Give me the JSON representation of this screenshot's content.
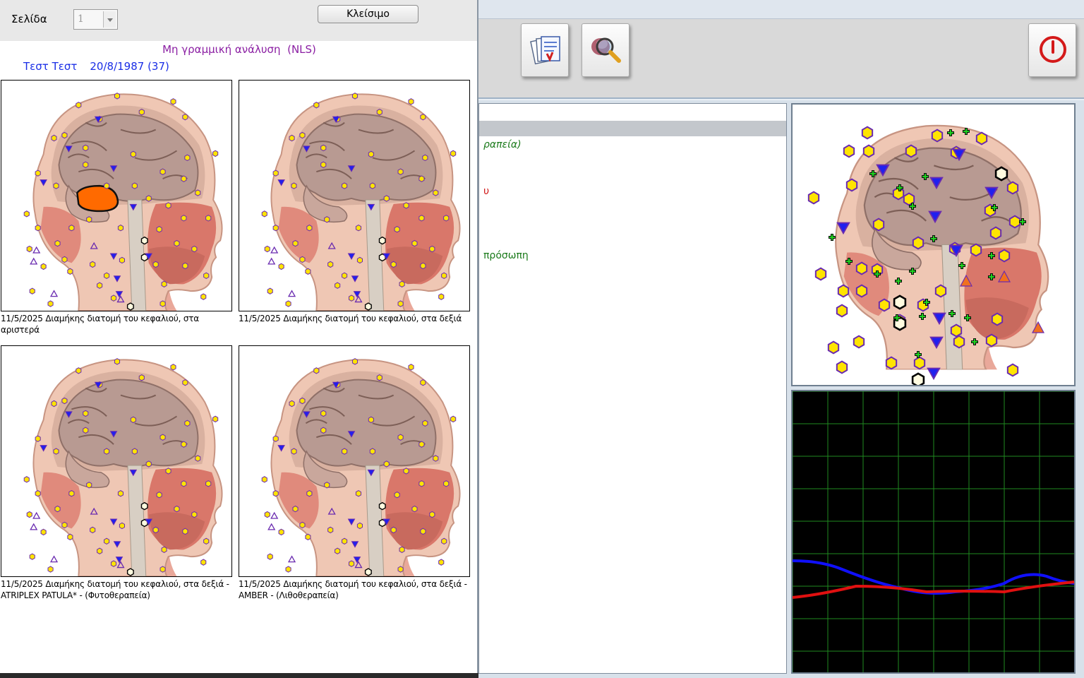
{
  "dialog": {
    "page_label": "Σελίδα",
    "page_value": "1",
    "close_label": "Κλείσιμο",
    "report_title": "Μη γραμμική ανάλυση  (NLS)",
    "patient_name": "Τεστ Τεστ",
    "patient_birth": "20/8/1987 (37)",
    "thumbnails": [
      {
        "caption": "11/5/2025  Διαμήκης διατομή του κεφαλιού, στα αριστερά"
      },
      {
        "caption": "11/5/2025  Διαμήκης διατομή του κεφαλιού, στα δεξιά"
      },
      {
        "caption": "11/5/2025  Διαμήκης διατομή του κεφαλιού, στα δεξιά - ATRIPLEX  PATULA* - (Φυτοθεραπεία)"
      },
      {
        "caption": "11/5/2025  Διαμήκης διατομή του κεφαλιού, στα δεξιά - AMBER - (Λιθοθεραπεία)"
      }
    ]
  },
  "main": {
    "toolbar": {
      "report_icon": "report-icon",
      "search_icon": "magnifier-icon",
      "power_icon": "power-icon"
    },
    "text_lines": [
      "ραπεία)",
      "υ",
      "πρόσωπη"
    ],
    "graph": {
      "series": [
        {
          "color": "#1010ff"
        },
        {
          "color": "#e01010"
        }
      ]
    }
  },
  "colors": {
    "marker_fill": "#ffe400",
    "marker_stroke": "#6a2bb0",
    "arrow_fill": "#2020ee",
    "highlight_fill": "#ff6a00",
    "grid": "#1f8a1f"
  }
}
